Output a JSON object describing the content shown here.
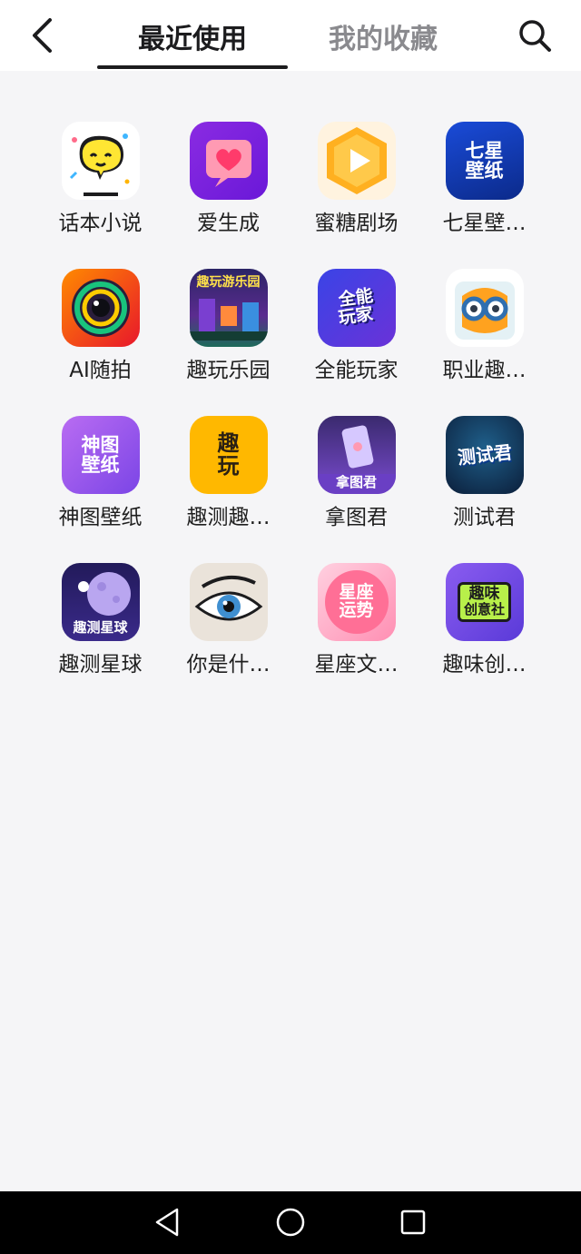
{
  "header": {
    "tabs": [
      {
        "label": "最近使用",
        "active": true
      },
      {
        "label": "我的收藏",
        "active": false
      }
    ]
  },
  "apps": [
    {
      "label": "话本小说",
      "icon": "speech-bubble-face-icon"
    },
    {
      "label": "爱生成",
      "icon": "heart-message-icon"
    },
    {
      "label": "蜜糖剧场",
      "icon": "play-hexagon-icon"
    },
    {
      "label": "七星壁…",
      "icon": "qixing-wallpaper-icon",
      "icon_text": [
        "七星",
        "壁纸"
      ]
    },
    {
      "label": "AI随拍",
      "icon": "camera-lens-icon"
    },
    {
      "label": "趣玩乐园",
      "icon": "game-scene-icon",
      "icon_text": [
        "趣玩游乐园"
      ]
    },
    {
      "label": "全能玩家",
      "icon": "all-round-player-icon",
      "icon_text": [
        "全能",
        "玩家"
      ]
    },
    {
      "label": "职业趣…",
      "icon": "owl-glasses-icon"
    },
    {
      "label": "神图壁纸",
      "icon": "shentu-wallpaper-icon",
      "icon_text": [
        "神图",
        "壁纸"
      ]
    },
    {
      "label": "趣测趣…",
      "icon": "quce-icon",
      "icon_text": [
        "趣",
        "玩"
      ]
    },
    {
      "label": "拿图君",
      "icon": "phone-hand-icon",
      "icon_text": [
        "拿图君"
      ]
    },
    {
      "label": "测试君",
      "icon": "ceshijun-icon",
      "icon_text": [
        "测试君"
      ]
    },
    {
      "label": "趣测星球",
      "icon": "planet-astronaut-icon",
      "icon_text": [
        "趣测星球"
      ]
    },
    {
      "label": "你是什…",
      "icon": "eye-icon"
    },
    {
      "label": "星座文…",
      "icon": "horoscope-icon",
      "icon_text": [
        "星座",
        "运势"
      ]
    },
    {
      "label": "趣味创…",
      "icon": "creative-club-icon",
      "icon_text": [
        "趣味",
        "创意社"
      ]
    }
  ],
  "colors": {
    "accent": "#1c1c1e",
    "inactive_tab": "#8a8a8e",
    "background": "#f5f5f7"
  }
}
